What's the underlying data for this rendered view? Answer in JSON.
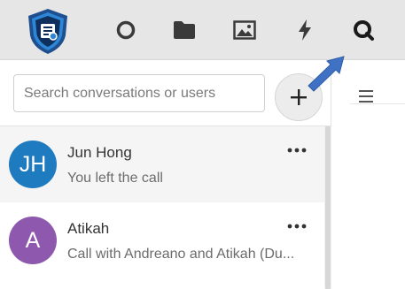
{
  "toolbar": {
    "icons": [
      "shield-logo",
      "circle-icon",
      "folder-icon",
      "image-icon",
      "lightning-icon",
      "search-icon"
    ]
  },
  "search": {
    "placeholder": "Search conversations or users"
  },
  "new_button": {
    "label": "+"
  },
  "conversations": [
    {
      "initials": "JH",
      "name": "Jun Hong",
      "preview": "You left the call",
      "avatar_color": "#1f7bc0",
      "more": "•••"
    },
    {
      "initials": "A",
      "name": "Atikah",
      "preview": "Call with Andreano and Atikah (Du...",
      "avatar_color": "#8e58ae",
      "more": "•••"
    }
  ],
  "colors": {
    "toolbar_bg": "#e6e6e6",
    "arrow": "#3f72c4",
    "logo_blue": "#1d5aa6"
  }
}
